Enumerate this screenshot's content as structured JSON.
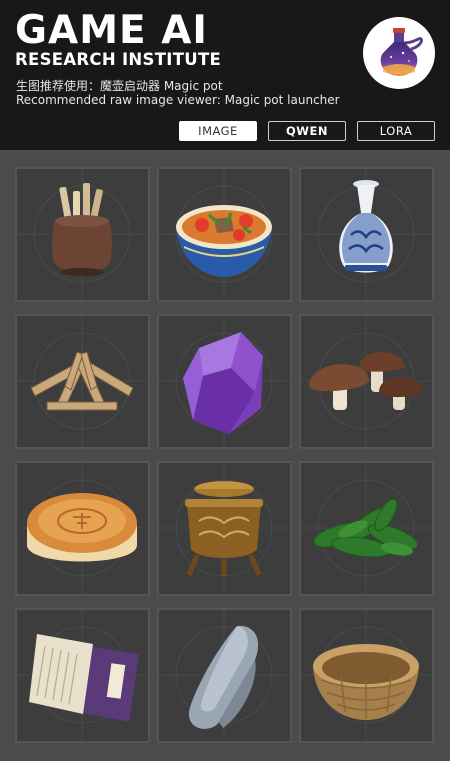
{
  "header": {
    "title": "GAME AI",
    "subtitle": "RESEARCH INSTITUTE",
    "desc_zh": "生图推荐使用：魔壶启动器 Magic pot",
    "desc_en": "Recommended raw image viewer: Magic pot launcher",
    "logo_icon": "magic-pot-icon"
  },
  "tabs": [
    {
      "label": "IMAGE",
      "active": true
    },
    {
      "label": "QWEN",
      "active": false
    },
    {
      "label": "LORA",
      "active": false
    }
  ],
  "items": [
    {
      "icon": "scroll-jar-icon"
    },
    {
      "icon": "soup-bowl-icon"
    },
    {
      "icon": "porcelain-vase-icon"
    },
    {
      "icon": "firewood-icon"
    },
    {
      "icon": "amethyst-crystal-icon"
    },
    {
      "icon": "mushrooms-icon"
    },
    {
      "icon": "mooncake-icon"
    },
    {
      "icon": "bronze-censer-icon"
    },
    {
      "icon": "herb-leaves-icon"
    },
    {
      "icon": "old-book-icon"
    },
    {
      "icon": "stone-icon"
    },
    {
      "icon": "wicker-basket-icon"
    }
  ],
  "colors": {
    "header_bg": "#181818",
    "page_bg": "#4b4b4b",
    "cell_bg": "#3d3d3d",
    "active_tab_bg": "#ffffff"
  }
}
